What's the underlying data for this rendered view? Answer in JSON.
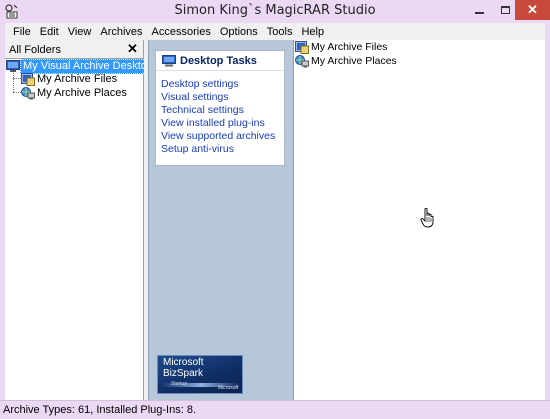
{
  "window": {
    "title": "Simon King`s MagicRAR Studio"
  },
  "menu": [
    "File",
    "Edit",
    "View",
    "Archives",
    "Accessories",
    "Options",
    "Tools",
    "Help"
  ],
  "folders_pane": {
    "title": "All Folders",
    "close_symbol": "✕",
    "tree": [
      {
        "label": "My Visual Archive Desktop",
        "icon": "desktop-icon",
        "selected": true
      },
      {
        "label": "My Archive Files",
        "icon": "archive-files-icon",
        "selected": false
      },
      {
        "label": "My Archive Places",
        "icon": "network-places-icon",
        "selected": false
      }
    ]
  },
  "tasks_pane": {
    "title": "Desktop Tasks",
    "links": [
      "Desktop settings",
      "Visual settings",
      "Technical settings",
      "View installed plug-ins",
      "View supported archives",
      "Setup anti-virus"
    ],
    "badge": {
      "line1": "Microsoft",
      "line2": "BizSpark",
      "line3": "Startup",
      "line4": "Microsoft"
    }
  },
  "content_pane": {
    "items": [
      {
        "label": "My Archive Files",
        "icon": "archive-files-icon"
      },
      {
        "label": "My Archive Places",
        "icon": "network-places-icon"
      }
    ]
  },
  "status": {
    "text": "Archive Types: 61, Installed Plug-Ins: 8."
  },
  "colors": {
    "window_frame": "#ebd9f4",
    "close_button": "#c7493a",
    "tasks_background": "#b5c7d8",
    "link": "#1a3cc0",
    "selection": "#3399ff"
  }
}
